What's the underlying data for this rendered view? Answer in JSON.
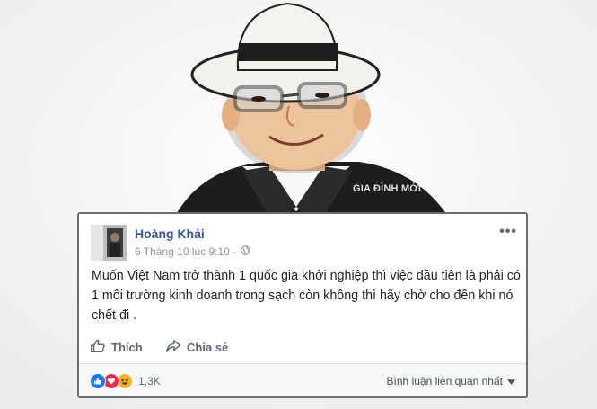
{
  "post": {
    "author": "Hoàng Khải",
    "timestamp": "6 Tháng 10 lúc 9:10",
    "separator": "·",
    "privacy_icon": "globe-icon",
    "more_label": "•••",
    "text": "Muốn Việt Nam trở thành 1 quốc gia khởi nghiệp thì việc đầu tiên là phải có 1 môi trường kinh doanh trong sạch còn không thì hãy chờ cho đến khi nó chết đi ."
  },
  "actions": {
    "like_label": "Thích",
    "share_label": "Chia sẻ"
  },
  "footer": {
    "reaction_count": "1,3K",
    "comment_sort_label": "Bình luận liên quan nhất"
  },
  "watermark": {
    "text": "GIA ĐÌNH MỚI"
  },
  "colors": {
    "author_link": "#365899",
    "meta_text": "#90949c",
    "like_reaction": "#1877f2",
    "love_reaction": "#f0284a",
    "haha_reaction": "#f7b125",
    "footer_bg": "#f6f7f9"
  }
}
